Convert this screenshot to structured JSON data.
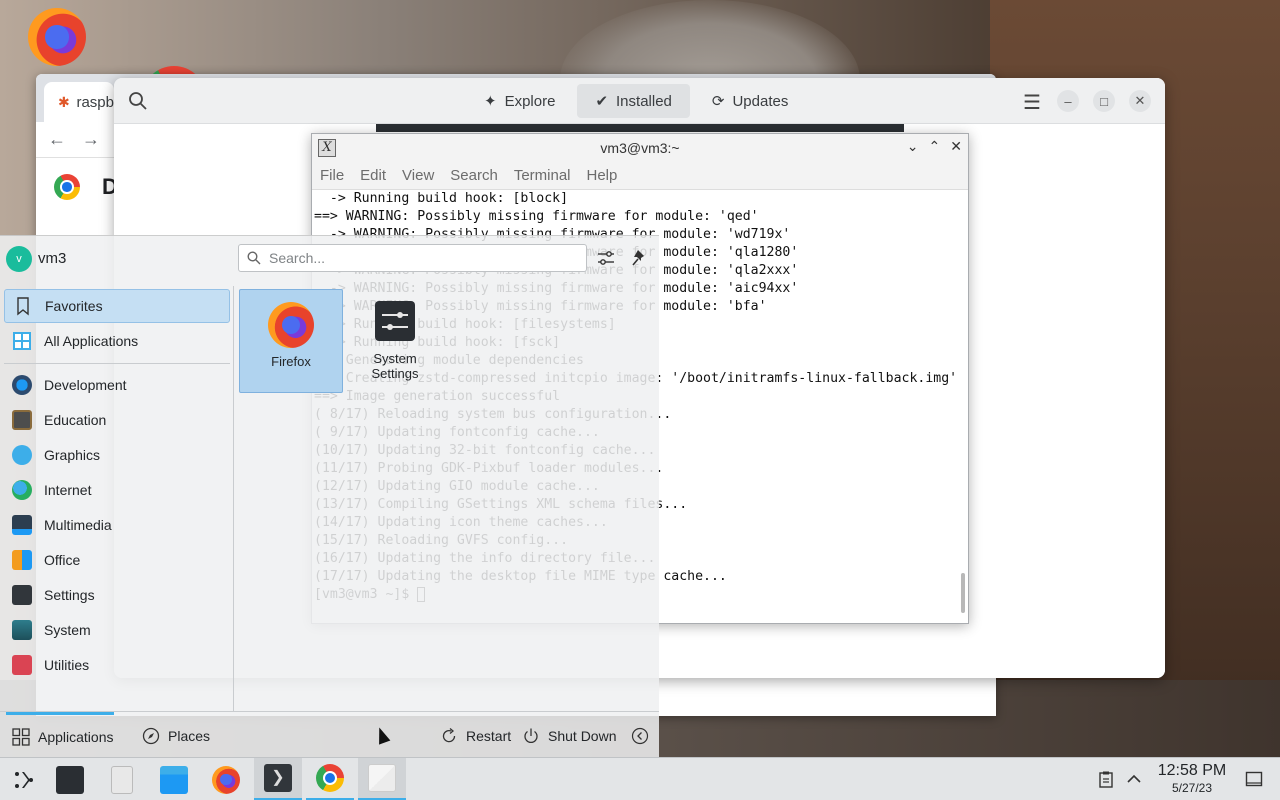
{
  "desktop": {
    "icons": [
      {
        "name": "firefox",
        "icon": "firefox-icon"
      },
      {
        "name": "chrome",
        "icon": "chrome-icon"
      }
    ]
  },
  "chrome_window": {
    "tab_label": "raspb",
    "page_letter": "D"
  },
  "discover": {
    "tabs": [
      {
        "label": "Explore",
        "icon": "sparkle-icon"
      },
      {
        "label": "Installed",
        "icon": "check-circle-icon"
      },
      {
        "label": "Updates",
        "icon": "refresh-icon"
      }
    ],
    "active_tab": "Installed"
  },
  "terminal": {
    "title": "vm3@vm3:~",
    "menu": [
      "File",
      "Edit",
      "View",
      "Search",
      "Terminal",
      "Help"
    ],
    "lines": [
      "  -> Running build hook: [block]",
      "==> WARNING: Possibly missing firmware for module: 'qed'",
      "  -> WARNING: Possibly missing firmware for module: 'wd719x'",
      "  -> WARNING: Possibly missing firmware for module: 'qla1280'",
      "  -> WARNING: Possibly missing firmware for module: 'qla2xxx'",
      "  -> WARNING: Possibly missing firmware for module: 'aic94xx'",
      "  -> WARNING: Possibly missing firmware for module: 'bfa'",
      "  -> Running build hook: [filesystems]",
      "  -> Running build hook: [fsck]",
      "==> Generating module dependencies",
      "==> Creating zstd-compressed initcpio image: '/boot/initramfs-linux-fallback.img'",
      "",
      "==> Image generation successful",
      "( 8/17) Reloading system bus configuration...",
      "( 9/17) Updating fontconfig cache...",
      "(10/17) Updating 32-bit fontconfig cache...",
      "(11/17) Probing GDK-Pixbuf loader modules...",
      "(12/17) Updating GIO module cache...",
      "(13/17) Compiling GSettings XML schema files...",
      "(14/17) Updating icon theme caches...",
      "(15/17) Reloading GVFS config...",
      "(16/17) Updating the info directory file...",
      "(17/17) Updating the desktop file MIME type cache...",
      "[vm3@vm3 ~]$ "
    ]
  },
  "launcher": {
    "user": {
      "initial": "v",
      "name": "vm3"
    },
    "search_placeholder": "Search...",
    "categories": [
      {
        "label": "Favorites",
        "icon": "bookmark-icon",
        "color": "#ffffff"
      },
      {
        "label": "All Applications",
        "icon": "grid-icon",
        "color": "#3daee9"
      },
      {
        "label": "Development",
        "icon": "development-icon",
        "color": "#1d99f3"
      },
      {
        "label": "Education",
        "icon": "education-icon",
        "color": "#4d4d4d"
      },
      {
        "label": "Graphics",
        "icon": "graphics-icon",
        "color": "#3daee9"
      },
      {
        "label": "Internet",
        "icon": "internet-icon",
        "color": "#27ae60"
      },
      {
        "label": "Multimedia",
        "icon": "multimedia-icon",
        "color": "#2c3e50"
      },
      {
        "label": "Office",
        "icon": "office-icon",
        "color": "#f39c1f"
      },
      {
        "label": "Settings",
        "icon": "settings-icon",
        "color": "#31363b"
      },
      {
        "label": "System",
        "icon": "system-icon",
        "color": "#2e7d8c"
      },
      {
        "label": "Utilities",
        "icon": "utilities-icon",
        "color": "#da4453"
      }
    ],
    "active_category": "Favorites",
    "apps": [
      {
        "label": "Firefox",
        "icon": "firefox-icon"
      },
      {
        "label": "System Settings",
        "icon": "system-settings-icon"
      }
    ],
    "footer": {
      "applications": "Applications",
      "places": "Places",
      "restart": "Restart",
      "shutdown": "Shut Down"
    }
  },
  "taskbar": {
    "items": [
      "launcher-icon",
      "system-settings-icon",
      "files-icon",
      "folder-icon",
      "firefox-icon",
      "terminal-icon",
      "chrome-icon",
      "discover-icon"
    ],
    "time": "12:58 PM",
    "date": "5/27/23"
  }
}
